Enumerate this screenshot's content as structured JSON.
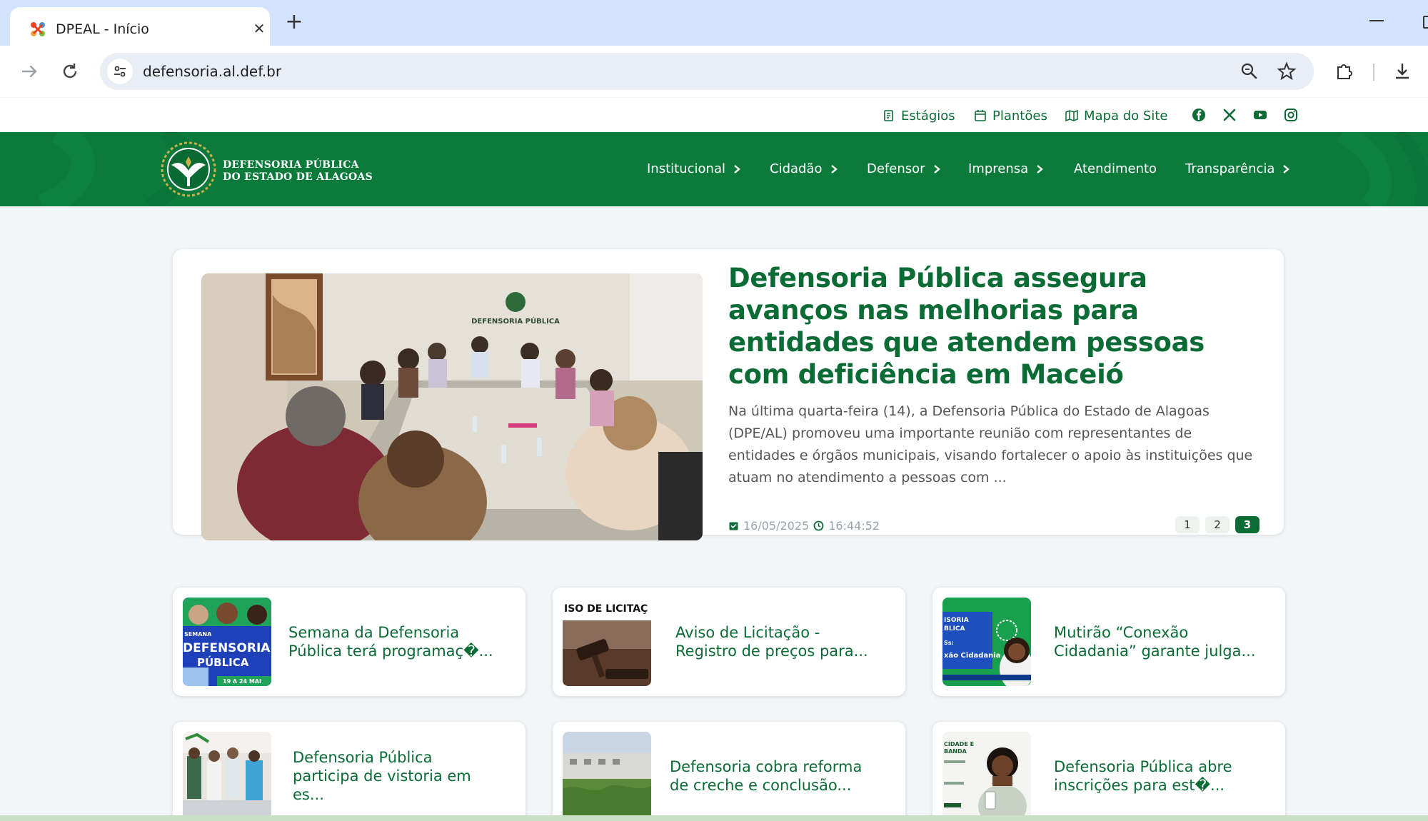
{
  "browser": {
    "tab_title": "DPEAL - Início",
    "url": "defensoria.al.def.br"
  },
  "utility": {
    "links": [
      "Estágios",
      "Plantões",
      "Mapa do Site"
    ],
    "social_icons": [
      "facebook-icon",
      "x-icon",
      "youtube-icon",
      "instagram-icon"
    ]
  },
  "logo": {
    "line1": "DEFENSORIA PÚBLICA",
    "line2": "DO ESTADO DE ALAGOAS"
  },
  "nav": {
    "items": [
      "Institucional",
      "Cidadão",
      "Defensor",
      "Imprensa",
      "Atendimento",
      "Transparência"
    ]
  },
  "featured": {
    "title": "Defensoria Pública assegura avanços nas melhorias para entidades que atendem pessoas com deficiência em Maceió",
    "excerpt": " Na última quarta-feira (14), a Defensoria Pública do Estado de Alagoas (DPE/AL) promoveu uma importante reunião com representantes de entidades e órgãos municipais, visando fortalecer o apoio às instituições que atuam no atendimento a pessoas com ...",
    "date": "16/05/2025",
    "time": "16:44:52",
    "pages": [
      "1",
      "2",
      "3"
    ],
    "active_page": "3",
    "photo_sign": "DEFENSORIA PÚBLICA"
  },
  "cards": [
    {
      "line1": "Semana da Defensoria",
      "line2": "Pública terá programaç�..."
    },
    {
      "line1": "Aviso de Licitação -",
      "line2": "Registro de preços para..."
    },
    {
      "line1": "Mutirão “Conexão",
      "line2": "Cidadania” garante julga..."
    },
    {
      "line1": "Defensoria Pública",
      "line2": "participa de vistoria em",
      "line3": "es..."
    },
    {
      "line1": "Defensoria cobra reforma",
      "line2": "de creche e conclusão..."
    },
    {
      "line1": "Defensoria Pública abre",
      "line2": "inscrições para est�..."
    }
  ],
  "thumbs": {
    "t1_lines": [
      "SEMANA",
      "DEFENSORIA",
      "PÚBLICA",
      "19 A 24 MAI"
    ],
    "t2_text": "ISO DE LICITAÇ",
    "t3_lines": [
      "ISORIA",
      "BLICA",
      "Ss:",
      "xão Cidadania"
    ],
    "t6_lines": [
      "CIDADE E",
      "BANDA"
    ]
  },
  "colors": {
    "brand_green": "#0b7a3b",
    "title_green": "#0b6b35",
    "tab_strip": "#d3e3fd"
  }
}
